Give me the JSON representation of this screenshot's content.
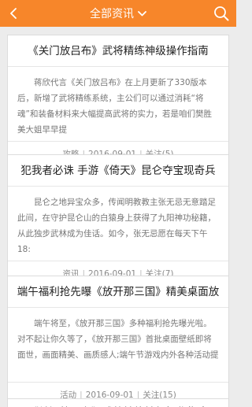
{
  "header": {
    "title": "全部资讯",
    "back_icon": "chevron-left-icon",
    "dropdown_icon": "chevron-down-icon",
    "search_icon": "search-icon",
    "accent_color": "#f7862a"
  },
  "articles": [
    {
      "title": "《关门放吕布》武将精练神级操作指南",
      "summary": "蒋欣代言《关门放吕布》在上月更新了330版本后，新增了武将精练系统，主公们可以通过消耗“将魂”和装备材料来大幅提高武将的实力，若是咱们樊胜美大姐早早提",
      "category": "攻略",
      "date": "2016-09-01",
      "follow": "关注(5)"
    },
    {
      "title": "犯我者必诛 手游《倚天》昆仑夺宝现奇兵",
      "summary": "昆仑之地异宝众多，传闻明教教主张无忌无意踏足此间，在守护昆仑山的白猿身上获得了九阳神功秘籍，从此独步武林成为佳话。如今，张无忌愿在每天下午18:",
      "category": "资讯",
      "date": "2016-09-01",
      "follow": "关注(7)"
    },
    {
      "title": "端午福利抢先曝《放开那三国》精美桌面放",
      "summary": "端午将至，《放开那三国》多种福利抢先曝光啦。对不起让你久等了，《放开那三国》首批桌面壁纸即将面世，画面精美、画质感人;端午节游戏内外各种活动提",
      "category": "活动",
      "date": "2016-09-01",
      "follow": "关注(15)"
    }
  ],
  "next_article_partial": "《关门放吕布》武将精练神级操作指南"
}
